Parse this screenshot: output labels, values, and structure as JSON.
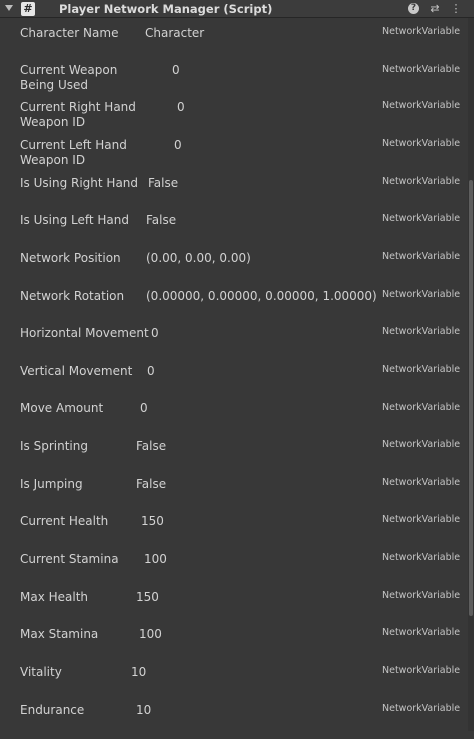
{
  "header": {
    "script_glyph": "#",
    "title": "Player Network Manager (Script)",
    "help_glyph": "?",
    "presets_glyph": "⇄",
    "more_glyph": "⋮"
  },
  "rows": [
    {
      "label": "Character Name",
      "value": "Character",
      "tag": "NetworkVariable"
    },
    {
      "label": "Current Weapon Being Used",
      "value": "0",
      "tag": "NetworkVariable"
    },
    {
      "label": "Current Right Hand Weapon ID",
      "value": "0",
      "tag": "NetworkVariable"
    },
    {
      "label": "Current Left Hand Weapon ID",
      "value": "0",
      "tag": "NetworkVariable"
    },
    {
      "label": "Is Using Right Hand",
      "value": "False",
      "tag": "NetworkVariable"
    },
    {
      "label": "Is Using Left Hand",
      "value": "False",
      "tag": "NetworkVariable"
    },
    {
      "label": "Network Position",
      "value": "(0.00, 0.00, 0.00)",
      "tag": "NetworkVariable"
    },
    {
      "label": "Network Rotation",
      "value": "(0.00000, 0.00000, 0.00000, 1.00000)",
      "tag": "NetworkVariable"
    },
    {
      "label": "Horizontal Movement",
      "value": "0",
      "tag": "NetworkVariable"
    },
    {
      "label": "Vertical Movement",
      "value": "0",
      "tag": "NetworkVariable"
    },
    {
      "label": "Move Amount",
      "value": "0",
      "tag": "NetworkVariable"
    },
    {
      "label": "Is Sprinting",
      "value": "False",
      "tag": "NetworkVariable"
    },
    {
      "label": "Is Jumping",
      "value": "False",
      "tag": "NetworkVariable"
    },
    {
      "label": "Current Health",
      "value": "150",
      "tag": "NetworkVariable"
    },
    {
      "label": "Current Stamina",
      "value": "100",
      "tag": "NetworkVariable"
    },
    {
      "label": "Max Health",
      "value": "150",
      "tag": "NetworkVariable"
    },
    {
      "label": "Max Stamina",
      "value": "100",
      "tag": "NetworkVariable"
    },
    {
      "label": "Vitality",
      "value": "10",
      "tag": "NetworkVariable"
    },
    {
      "label": "Endurance",
      "value": "10",
      "tag": "NetworkVariable"
    }
  ]
}
